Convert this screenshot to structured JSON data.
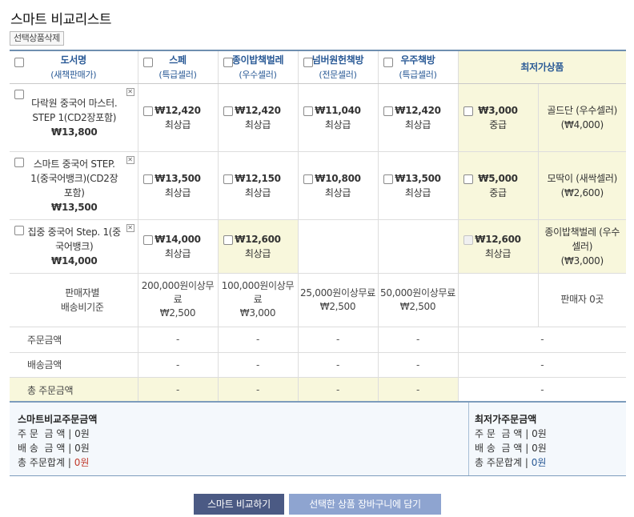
{
  "page": {
    "title": "스마트 비교리스트",
    "delete_label": "선택상품삭제"
  },
  "headers": {
    "book": {
      "name": "도서명",
      "sub": "(새책판매가)"
    },
    "sellers": [
      {
        "name": "스페",
        "sub": "(특급셀러)"
      },
      {
        "name": "종이밥책벌레",
        "sub": "(우수셀러)"
      },
      {
        "name": "넘버원헌책방",
        "sub": "(전문셀러)"
      },
      {
        "name": "우주책방",
        "sub": "(특급셀러)"
      }
    ],
    "lowest": "최저가상품"
  },
  "books": [
    {
      "title": "다락원 중국어 마스터. STEP 1(CD2장포함)",
      "price": "₩13,800",
      "offers": [
        {
          "price": "₩12,420",
          "grade": "최상급"
        },
        {
          "price": "₩12,420",
          "grade": "최상급"
        },
        {
          "price": "₩11,040",
          "grade": "최상급"
        },
        {
          "price": "₩12,420",
          "grade": "최상급"
        }
      ],
      "lowest": {
        "price": "₩3,000",
        "grade": "중급",
        "seller": "골드단 (우수셀러)",
        "shipping": "(₩4,000)"
      }
    },
    {
      "title": "스마트 중국어 STEP. 1(중국어뱅크)(CD2장포함)",
      "price": "₩13,500",
      "offers": [
        {
          "price": "₩13,500",
          "grade": "최상급"
        },
        {
          "price": "₩12,150",
          "grade": "최상급"
        },
        {
          "price": "₩10,800",
          "grade": "최상급"
        },
        {
          "price": "₩13,500",
          "grade": "최상급"
        }
      ],
      "lowest": {
        "price": "₩5,000",
        "grade": "중급",
        "seller": "모딱이 (새싹셀러)",
        "shipping": "(₩2,600)"
      }
    },
    {
      "title": "집중 중국어 Step. 1(중국어뱅크)",
      "price": "₩14,000",
      "offers": [
        {
          "price": "₩14,000",
          "grade": "최상급"
        },
        {
          "price": "₩12,600",
          "grade": "최상급"
        },
        null,
        null
      ],
      "lowest": {
        "price": "₩12,600",
        "grade": "최상급",
        "seller": "종이밥책벌레 (우수셀러)",
        "shipping": "(₩3,000)"
      }
    }
  ],
  "shipping": {
    "label_line1": "판매자별",
    "label_line2": "배송비기준",
    "sellers": [
      {
        "rule": "200,000원이상무료",
        "fee": "₩2,500"
      },
      {
        "rule": "100,000원이상무료",
        "fee": "₩3,000"
      },
      {
        "rule": "25,000원이상무료",
        "fee": "₩2,500"
      },
      {
        "rule": "50,000원이상무료",
        "fee": "₩2,500"
      }
    ],
    "lowest": "판매자 0곳"
  },
  "totals": {
    "order_label": "주문금액",
    "ship_label": "배송금액",
    "total_label": "총 주문금액",
    "dash": "-"
  },
  "summary": {
    "smart": {
      "title": "스마트비교주문금액",
      "order": "주 문  금 액 | 0원",
      "ship": "배 송  금 액 | 0원",
      "total_label": "총 주문합계 | ",
      "total_value": "0원"
    },
    "lowest": {
      "title": "최저가주문금액",
      "order": "주 문  금 액 | 0원",
      "ship": "배 송  금 액 | 0원",
      "total_label": "총 주문합계 | ",
      "total_value": "0원"
    }
  },
  "buttons": {
    "compare": "스마트 비교하기",
    "cart": "선택한 상품 장바구니에 담기"
  },
  "colors": {
    "accent_blue": "#2a5a96",
    "highlight": "#f8f7dc",
    "summary_bg": "#f4f8fc",
    "button_dark": "#4b5a84",
    "button_light": "#8ea4d0",
    "total_red": "#c0392b"
  }
}
